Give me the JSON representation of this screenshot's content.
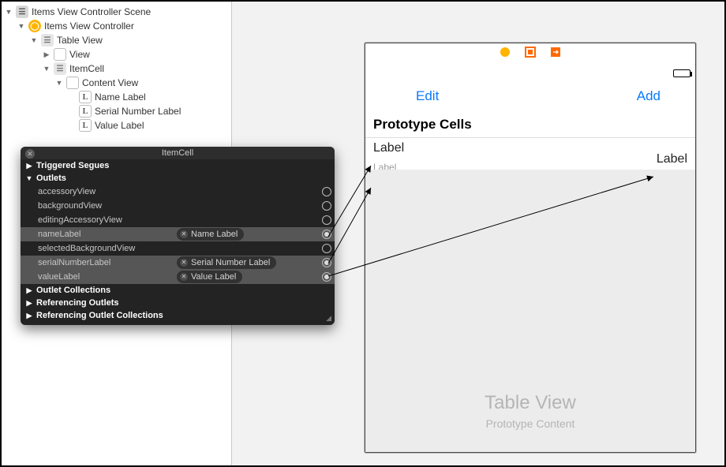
{
  "outline": {
    "scene": "Items View Controller Scene",
    "vc": "Items View Controller",
    "table": "Table View",
    "view": "View",
    "cell": "ItemCell",
    "content": "Content View",
    "label1": "Name Label",
    "label2": "Serial Number Label",
    "label3": "Value Label"
  },
  "panel": {
    "title": "ItemCell",
    "sections": {
      "triggered": "Triggered Segues",
      "outlets": "Outlets",
      "collections": "Outlet Collections",
      "refOutlets": "Referencing Outlets",
      "refCollections": "Referencing Outlet Collections"
    },
    "outlets": [
      {
        "name": "accessoryView",
        "target": null
      },
      {
        "name": "backgroundView",
        "target": null
      },
      {
        "name": "editingAccessoryView",
        "target": null
      },
      {
        "name": "nameLabel",
        "target": "Name Label"
      },
      {
        "name": "selectedBackgroundView",
        "target": null
      },
      {
        "name": "serialNumberLabel",
        "target": "Serial Number Label"
      },
      {
        "name": "valueLabel",
        "target": "Value Label"
      }
    ]
  },
  "phone": {
    "nav": {
      "left": "Edit",
      "right": "Add"
    },
    "section_header": "Prototype Cells",
    "label_main": "Label",
    "label_sub": "Label",
    "label_right": "Label",
    "placeholder_big": "Table View",
    "placeholder_small": "Prototype Content"
  }
}
